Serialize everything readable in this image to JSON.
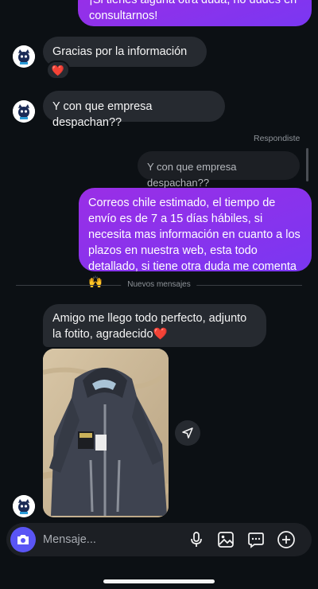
{
  "messages": {
    "top_outgoing_fragment": "¡Si tienes alguna otra duda, no dudes en consultarnos!",
    "incoming_1": "Gracias por la información🤏",
    "incoming_1_reaction": "❤️",
    "incoming_2": "Y con que empresa despachan??",
    "reply_meta": "Respondiste",
    "reply_quote": "Y con que empresa despachan??",
    "outgoing_reply": "Correos chile estimado, el tiempo de envío es de 7 a 15 días hábiles, si necesita mas información en cuanto a los plazos en nuestra web, esta todo detallado, si tiene otra duda me comenta🙌",
    "new_messages_divider": "Nuevos mensajes",
    "incoming_3": "Amigo me llego todo perfecto, adjunto la fotito, agradecido❤️"
  },
  "composer": {
    "placeholder": "Mensaje..."
  },
  "icons": {
    "camera": "camera-icon",
    "mic": "microphone-icon",
    "gallery": "image-icon",
    "sticker": "sticker-icon",
    "add": "plus-icon",
    "share": "send-icon"
  },
  "colors": {
    "background": "#0c1014",
    "incoming_bubble": "#262a30",
    "outgoing_bubble": "#8a33ee",
    "camera_button": "#5a55f5"
  }
}
